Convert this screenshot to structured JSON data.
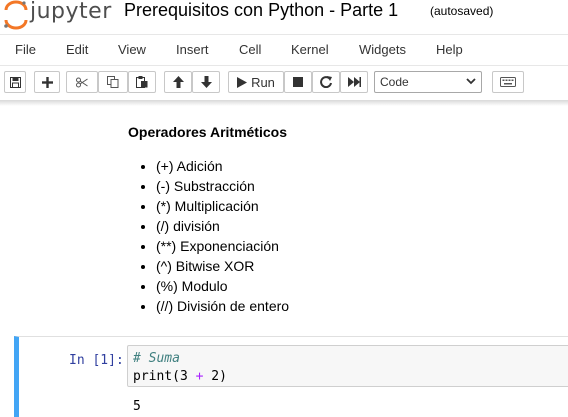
{
  "header": {
    "logo_text": "jupyter",
    "notebook_title": "Prerequisitos con Python - Parte 1",
    "save_status": "(autosaved)"
  },
  "menu": [
    "File",
    "Edit",
    "View",
    "Insert",
    "Cell",
    "Kernel",
    "Widgets",
    "Help"
  ],
  "toolbar": {
    "run_label": "Run",
    "cell_type": "Code",
    "icons": [
      "save-icon",
      "plus-icon",
      "scissors-icon",
      "copy-icon",
      "paste-icon",
      "arrow-up-icon",
      "arrow-down-icon",
      "play-icon",
      "stop-icon",
      "restart-icon",
      "fast-forward-icon",
      "keyboard-icon"
    ]
  },
  "markdown_cell": {
    "heading": "Operadores Aritméticos",
    "items": [
      "(+) Adición",
      "(-) Substracción",
      "(*) Multiplicación",
      "(/) división",
      "(**) Exponenciación",
      "(^) Bitwise XOR",
      "(%) Modulo",
      "(//) División de entero"
    ]
  },
  "code_cell": {
    "prompt": "In [1]:",
    "line1": "# Suma",
    "line2_a": "print(3 ",
    "line2_op": "+",
    "line2_b": " 2)",
    "output": "5"
  },
  "colors": {
    "accent": "#42a5f5",
    "prompt": "#303f9f",
    "logo_orange": "#f37726"
  }
}
